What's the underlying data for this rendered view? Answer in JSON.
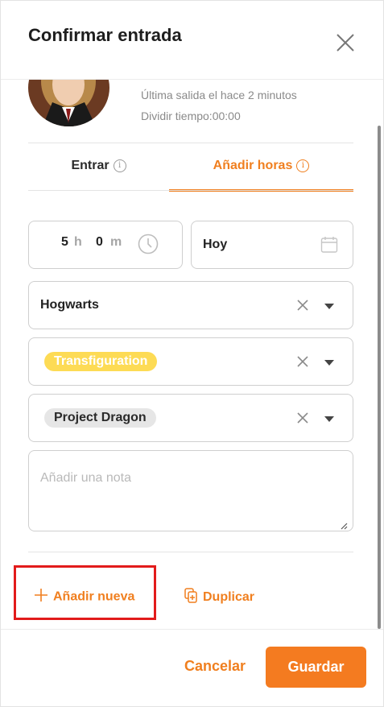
{
  "header": {
    "title": "Confirmar entrada"
  },
  "profile": {
    "last_exit": "Última salida el hace 2 minutos",
    "split_time": "Dividir tiempo:00:00"
  },
  "tabs": [
    {
      "label": "Entrar",
      "active": false
    },
    {
      "label": "Añadir horas",
      "active": true
    }
  ],
  "form": {
    "hours_value": "5",
    "hours_unit": "h",
    "minutes_value": "0",
    "minutes_unit": "m",
    "date_value": "Hoy",
    "client": "Hogwarts",
    "tag": "Transfiguration",
    "project": "Project Dragon",
    "note_placeholder": "Añadir una nota"
  },
  "actions": {
    "add_new": "Añadir nueva",
    "duplicate": "Duplicar"
  },
  "footer": {
    "cancel": "Cancelar",
    "save": "Guardar"
  },
  "colors": {
    "accent": "#f07f1f",
    "save_bg": "#f47b20",
    "tag_yellow": "#fddb55",
    "highlight_red": "#e21b1b"
  },
  "icons": [
    "close-icon",
    "info-icon",
    "clock-icon",
    "calendar-icon",
    "clear-icon",
    "dropdown-caret-icon",
    "plus-icon",
    "duplicate-icon",
    "resize-grip-icon"
  ]
}
